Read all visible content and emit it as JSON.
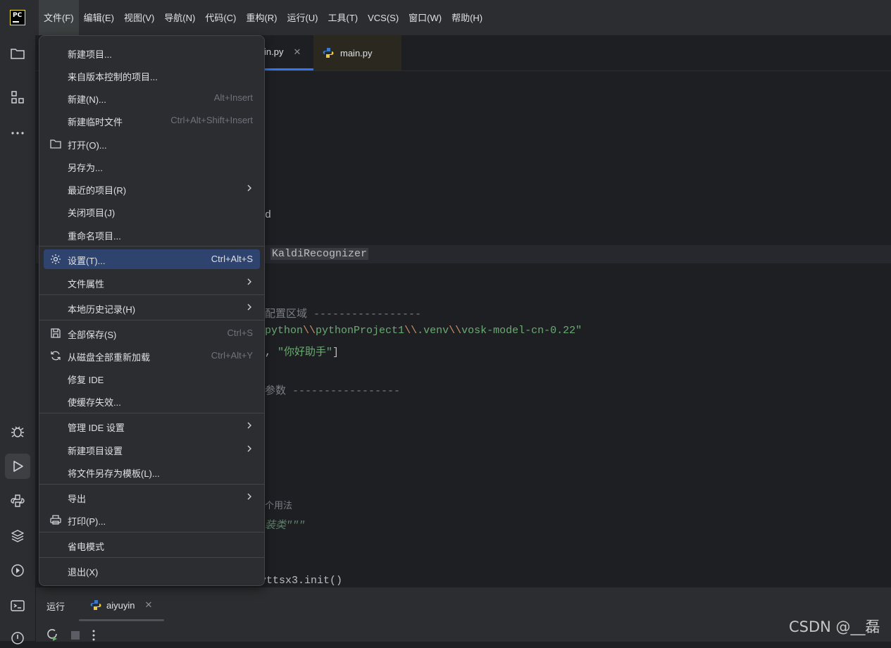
{
  "menubar": {
    "items": [
      "文件(F)",
      "编辑(E)",
      "视图(V)",
      "导航(N)",
      "代码(C)",
      "重构(R)",
      "运行(U)",
      "工具(T)",
      "VCS(S)",
      "窗口(W)",
      "帮助(H)"
    ]
  },
  "app_logo": "PC",
  "tabs": [
    {
      "label": "in.py"
    },
    {
      "label": "main.py"
    }
  ],
  "file_menu": {
    "items": [
      {
        "label": "新建项目..."
      },
      {
        "label": "来自版本控制的项目..."
      },
      {
        "label": "新建(N)...",
        "shortcut": "Alt+Insert"
      },
      {
        "label": "新建临时文件",
        "shortcut": "Ctrl+Alt+Shift+Insert"
      },
      {
        "label": "打开(O)...",
        "icon": "folder-icon"
      },
      {
        "label": "另存为..."
      },
      {
        "label": "最近的项目(R)",
        "submenu": true
      },
      {
        "label": "关闭项目(J)"
      },
      {
        "label": "重命名项目..."
      },
      {
        "label": "设置(T)...",
        "shortcut": "Ctrl+Alt+S",
        "icon": "gear-icon",
        "selected": true
      },
      {
        "label": "文件属性",
        "submenu": true
      },
      {
        "label": "本地历史记录(H)",
        "submenu": true
      },
      {
        "label": "全部保存(S)",
        "shortcut": "Ctrl+S",
        "icon": "save-icon"
      },
      {
        "label": "从磁盘全部重新加载",
        "shortcut": "Ctrl+Alt+Y",
        "icon": "reload-icon"
      },
      {
        "label": "修复 IDE"
      },
      {
        "label": "使缓存失效..."
      },
      {
        "label": "管理 IDE 设置",
        "submenu": true
      },
      {
        "label": "新建项目设置",
        "submenu": true
      },
      {
        "label": "将文件另存为模板(L)..."
      },
      {
        "label": "导出",
        "submenu": true
      },
      {
        "label": "打印(P)...",
        "icon": "printer-icon"
      },
      {
        "label": "省电模式"
      },
      {
        "label": "退出(X)"
      }
    ]
  },
  "editor": {
    "line_d": "d",
    "kaldi": "KaldiRecognizer",
    "comment_config": "配置区域 -----------------",
    "path_p1": "python",
    "path_esc1": "\\\\",
    "path_p2": "pythonProject1",
    "path_esc2": "\\\\",
    "path_p3": ".venv",
    "path_esc3": "\\\\",
    "path_p4": "vosk-model-cn-0.22\"",
    "wake_prefix": ", ",
    "wake_word": "\"你好助手\"",
    "wake_bracket": "]",
    "comment_params": "参数 -----------------",
    "usage_hint": "个用法",
    "docstring": "装类\"\"\"",
    "init_call": "yttsx3.init()"
  },
  "bottom_panel": {
    "run_label": "运行",
    "run_config": "aiyuyin"
  },
  "watermark": "CSDN @__磊",
  "colors": {
    "accent": "#3574f0",
    "menu_selected": "#2e436e",
    "string": "#6aab73",
    "comment": "#7a7e85"
  }
}
